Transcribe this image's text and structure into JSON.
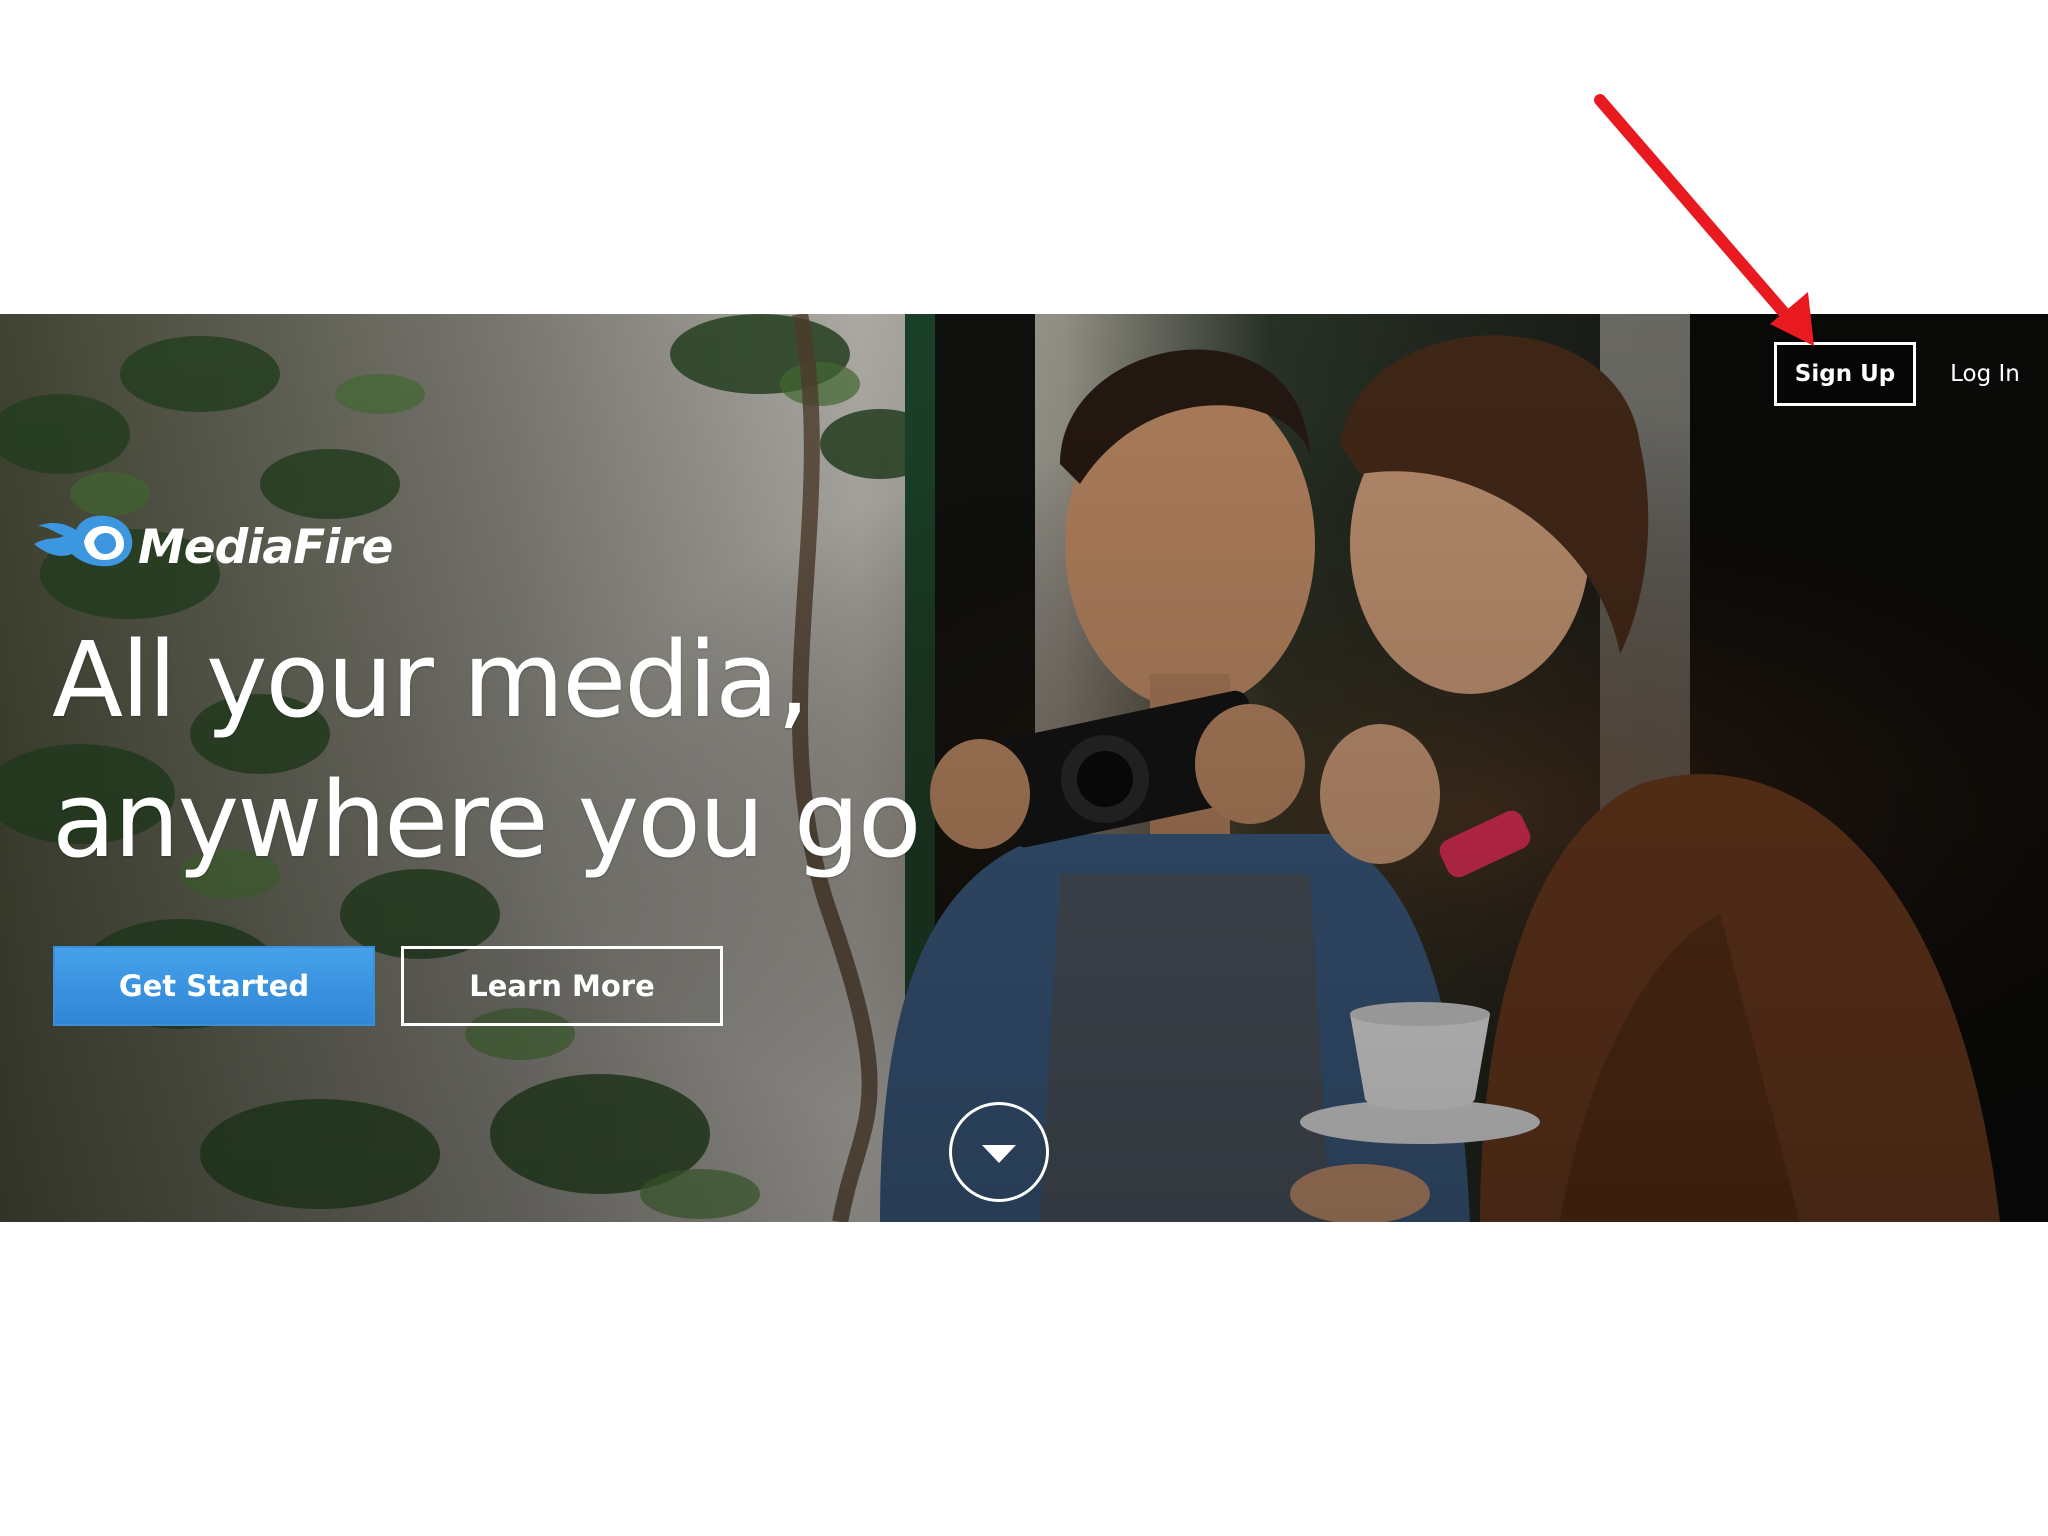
{
  "brand": {
    "name": "MediaFire",
    "logo_icon": "flame-cloud-icon",
    "accent_color": "#3a8fd9"
  },
  "nav": {
    "signup_label": "Sign Up",
    "login_label": "Log In"
  },
  "hero": {
    "headline_line1": "All your media,",
    "headline_line2": "anywhere you go",
    "get_started_label": "Get Started",
    "learn_more_label": "Learn More",
    "scroll_icon": "chevron-down-icon",
    "photo": "couple-with-camera-photo"
  },
  "annotation": {
    "arrow_color": "#e8191f",
    "arrow_icon": "red-arrow-icon"
  }
}
